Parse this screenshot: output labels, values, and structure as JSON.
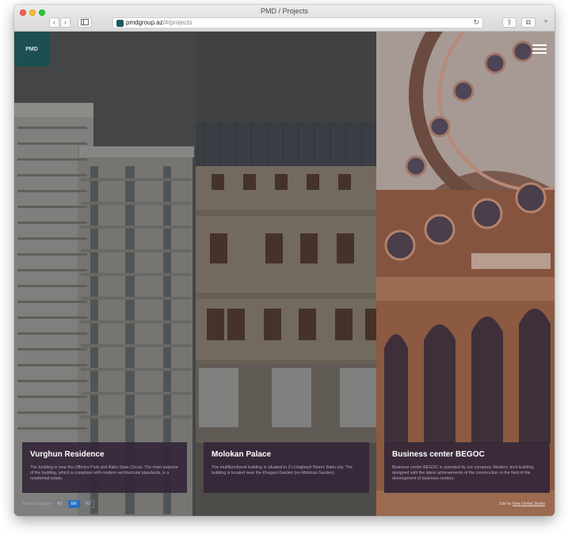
{
  "browser": {
    "window_title": "PMD / Projects",
    "url_host": "pmdgroup.az",
    "url_path": "/#/projects"
  },
  "site": {
    "logo_text": "PMD",
    "language_label": "Select language:",
    "languages": [
      "AZ",
      "EN",
      "RU"
    ],
    "credit_prefix": "Site by",
    "credit_link": "Idea Global Studio"
  },
  "projects": [
    {
      "title": "Vurghun Residence",
      "description": "The building is near the Officers Park and Baku State Circus. The main purpose of the building, which is compliant with modern architectural standards, is a residential estate."
    },
    {
      "title": "Molokan Palace",
      "description": "The multifunctional building is situated in 3 U.Hajibeyli Street, Baku city. The building is located near the Khagani Garden (ex-Molokan Garden)."
    },
    {
      "title": "Business center BEGOC",
      "description": "Business center BEGOC is operated by our company. Modern, tech building, designed with the latest achievements of the construction in the field of the development of business centers."
    }
  ]
}
